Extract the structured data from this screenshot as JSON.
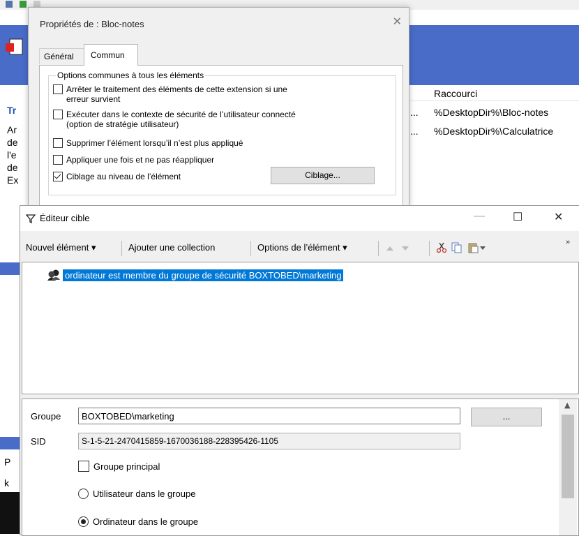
{
  "background": {
    "column_header": "Raccourci",
    "rows": [
      "%DesktopDir%\\Bloc-notes",
      "%DesktopDir%\\Calculatrice"
    ],
    "ellipsis": "...",
    "left_fragments": [
      "Tr",
      "Ar",
      "de",
      "l'e",
      "de",
      "Ex",
      "P",
      "k"
    ]
  },
  "props_dialog": {
    "title": "Propriétés de : Bloc-notes",
    "close": "✕",
    "tabs": [
      {
        "label": "Général"
      },
      {
        "label": "Commun"
      }
    ],
    "group_label": "Options communes à tous les éléments",
    "options": [
      {
        "label": "Arrêter le traitement des éléments de cette extension si une",
        "label2": "erreur survient",
        "checked": false
      },
      {
        "label": "Exécuter dans le contexte de sécurité de l’utilisateur connecté",
        "label2": "(option de stratégie utilisateur)",
        "checked": false
      },
      {
        "label": "Supprimer l’élément lorsqu’il n’est plus appliqué",
        "checked": false
      },
      {
        "label": "Appliquer une fois et ne pas réappliquer",
        "checked": false
      },
      {
        "label": "Ciblage au niveau de l’élément",
        "checked": true
      }
    ],
    "ciblage_button": "Ciblage..."
  },
  "editor": {
    "title": "Éditeur cible",
    "minimize": "—",
    "maximize": "☐",
    "close": "✕",
    "toolbar": {
      "new_item": "Nouvel élément ▾",
      "add_collection": "Ajouter une collection",
      "item_options": "Options de l’élément ▾",
      "overflow": "»"
    },
    "tree_item": "ordinateur est membre du groupe de sécurité BOXTOBED\\marketing",
    "groupe_label": "Groupe",
    "groupe_value": "BOXTOBED\\marketing",
    "browse_button": "...",
    "sid_label": "SID",
    "sid_value": "S-1-5-21-2470415859-1670036188-228395426-1105",
    "primary_group": "Groupe principal",
    "radio_user": "Utilisateur dans le groupe",
    "radio_computer": "Ordinateur dans le groupe",
    "selected_radio": "computer"
  },
  "colors": {
    "accent": "#0078d7",
    "banner": "#4a6cc9"
  }
}
